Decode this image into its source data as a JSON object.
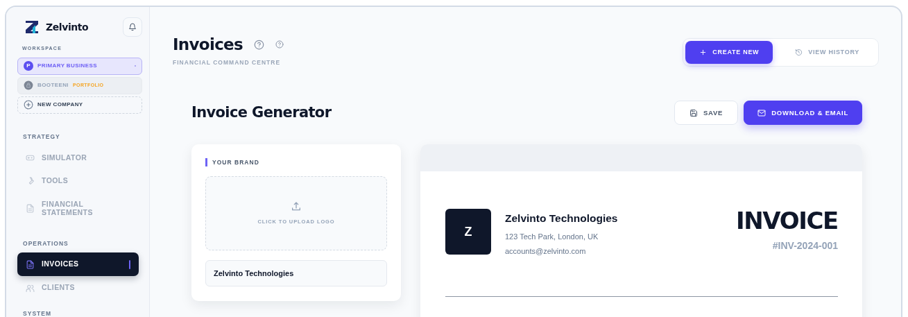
{
  "sidebar": {
    "brand": "Zelvinto",
    "workspace_label": "WORKSPACE",
    "workspaces": [
      {
        "kind": "company",
        "initial": "P",
        "name": "PRIMARY BUSINESS",
        "selected": true
      },
      {
        "kind": "locked",
        "name": "BOOTEENI",
        "tag": "PORTFOLIO",
        "selected": false
      },
      {
        "kind": "add",
        "name": "NEW COMPANY",
        "selected": false
      }
    ],
    "sections": [
      {
        "title": "STRATEGY",
        "items": [
          {
            "label": "SIMULATOR",
            "selected": false
          },
          {
            "label": "TOOLS",
            "selected": false
          },
          {
            "label": "FINANCIAL STATEMENTS",
            "selected": false
          }
        ]
      },
      {
        "title": "OPERATIONS",
        "items": [
          {
            "label": "INVOICES",
            "selected": true
          },
          {
            "label": "CLIENTS",
            "selected": false
          }
        ]
      },
      {
        "title": "SYSTEM"
      }
    ]
  },
  "header": {
    "title": "Invoices",
    "subtitle": "FINANCIAL COMMAND CENTRE",
    "actions": [
      {
        "label": "CREATE NEW",
        "selected": true
      },
      {
        "label": "VIEW HISTORY",
        "selected": false
      }
    ]
  },
  "generator": {
    "title": "Invoice Generator",
    "buttons": [
      {
        "kind": "outline",
        "label": "SAVE"
      },
      {
        "kind": "primary",
        "label": "DOWNLOAD & EMAIL"
      }
    ],
    "brand_card": {
      "title": "YOUR BRAND",
      "upload_text": "CLICK TO UPLOAD LOGO",
      "company_name": "Zelvinto Technologies"
    },
    "preview": {
      "logo_letter": "Z",
      "company": "Zelvinto Technologies",
      "address": "123 Tech Park, London, UK",
      "email": "accounts@zelvinto.com",
      "doc_title": "INVOICE",
      "number": "#INV-2024-001"
    }
  }
}
